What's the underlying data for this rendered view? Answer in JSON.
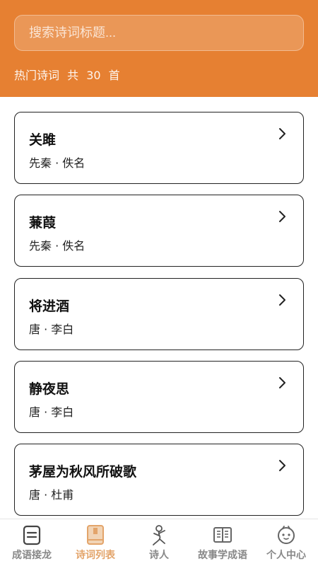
{
  "search": {
    "placeholder": "搜索诗词标题..."
  },
  "hot": {
    "label": "热门诗词",
    "count_prefix": "共",
    "count": "30",
    "count_suffix": "首"
  },
  "poems": [
    {
      "title": "关雎",
      "meta": "先秦 · 佚名"
    },
    {
      "title": "蒹葭",
      "meta": "先秦 · 佚名"
    },
    {
      "title": "将进酒",
      "meta": "唐 · 李白"
    },
    {
      "title": "静夜思",
      "meta": "唐 · 李白"
    },
    {
      "title": "茅屋为秋风所破歌",
      "meta": "唐 · 杜甫"
    }
  ],
  "tabs": [
    {
      "label": "成语接龙",
      "icon": "game-card-icon",
      "active": false
    },
    {
      "label": "诗词列表",
      "icon": "book-icon",
      "active": true
    },
    {
      "label": "诗人",
      "icon": "poet-icon",
      "active": false
    },
    {
      "label": "故事学成语",
      "icon": "open-book-icon",
      "active": false
    },
    {
      "label": "个人中心",
      "icon": "face-icon",
      "active": false
    }
  ],
  "colors": {
    "header": "#e68032",
    "tab_active": "#e3a46a",
    "tab_inactive": "#888888"
  }
}
